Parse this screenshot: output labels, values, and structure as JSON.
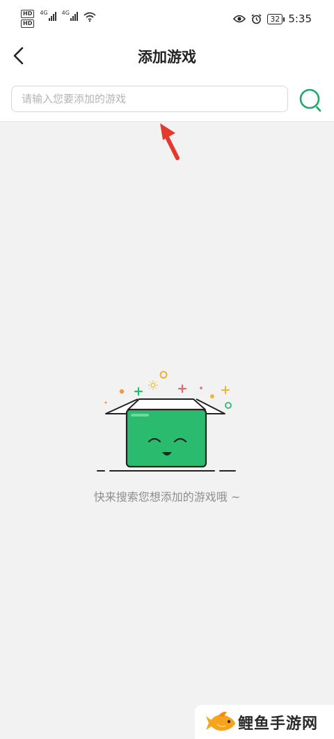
{
  "status_bar": {
    "hd_badges": [
      "HD",
      "HD"
    ],
    "network_labels": [
      "4G",
      "4G"
    ],
    "battery": "32",
    "time": "5:35",
    "icons": [
      "signal-icon",
      "wifi-icon",
      "eye-icon",
      "alarm-icon",
      "battery-icon"
    ]
  },
  "header": {
    "title": "添加游戏",
    "back_icon": "chevron-left-icon"
  },
  "search": {
    "placeholder": "请输入您要添加的游戏",
    "value": "",
    "button_icon": "search-icon",
    "accent_color": "#1ea86a"
  },
  "annotation": {
    "icon": "red-arrow-icon",
    "color": "#e23b2e"
  },
  "empty_state": {
    "illustration": "smiling-green-box-icon",
    "box_color": "#2bbb6e",
    "message": "快来搜索您想添加的游戏哦 ~"
  },
  "watermark": {
    "icon": "goldfish-logo-icon",
    "text": "鲤鱼手游网"
  }
}
